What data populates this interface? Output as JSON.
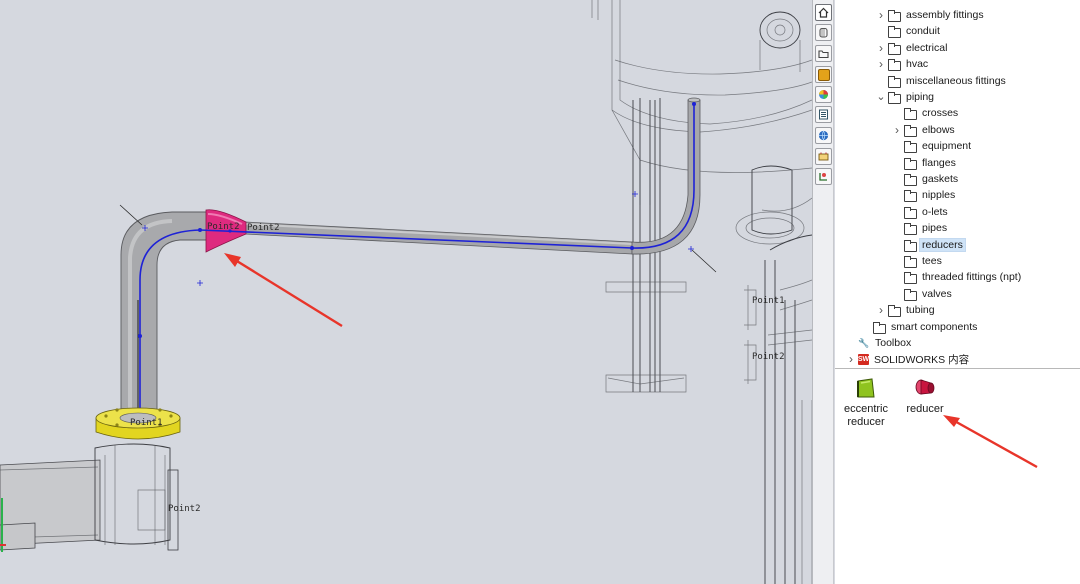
{
  "viewport": {
    "point_labels": [
      "Point2",
      "Point2",
      "Point2",
      "Point1",
      "Point2",
      "Point1"
    ],
    "colors": {
      "pipe": "#a9a9ab",
      "route_line": "#1e22d6",
      "reducer": "#de2a7f",
      "flange": "#e2d520",
      "annotation_arrow": "#e8352a"
    }
  },
  "taskpane_tabs": [
    {
      "name": "home-icon",
      "active": true
    },
    {
      "name": "design-library-icon",
      "active": false
    },
    {
      "name": "file-explorer-icon",
      "active": false
    },
    {
      "name": "view-palette-icon",
      "active": false
    },
    {
      "name": "appearances-icon",
      "active": false
    },
    {
      "name": "custom-properties-icon",
      "active": false
    },
    {
      "name": "solidworks-forum-icon",
      "active": false
    },
    {
      "name": "plugins-icon",
      "active": false
    },
    {
      "name": "routing-library-icon",
      "active": false
    }
  ],
  "tree": {
    "items": [
      {
        "label": "assembly fittings",
        "level": 1,
        "expand": "collapsed",
        "icon": "folder-icon"
      },
      {
        "label": "conduit",
        "level": 1,
        "expand": "none",
        "icon": "folder-icon"
      },
      {
        "label": "electrical",
        "level": 1,
        "expand": "collapsed",
        "icon": "folder-icon"
      },
      {
        "label": "hvac",
        "level": 1,
        "expand": "collapsed",
        "icon": "folder-icon"
      },
      {
        "label": "miscellaneous fittings",
        "level": 1,
        "expand": "none",
        "icon": "folder-icon"
      },
      {
        "label": "piping",
        "level": 1,
        "expand": "expanded",
        "icon": "folder-icon"
      },
      {
        "label": "crosses",
        "level": 2,
        "expand": "none",
        "icon": "folder-icon"
      },
      {
        "label": "elbows",
        "level": 2,
        "expand": "collapsed",
        "icon": "folder-icon"
      },
      {
        "label": "equipment",
        "level": 2,
        "expand": "none",
        "icon": "folder-icon"
      },
      {
        "label": "flanges",
        "level": 2,
        "expand": "none",
        "icon": "folder-icon"
      },
      {
        "label": "gaskets",
        "level": 2,
        "expand": "none",
        "icon": "folder-icon"
      },
      {
        "label": "nipples",
        "level": 2,
        "expand": "none",
        "icon": "folder-icon"
      },
      {
        "label": "o-lets",
        "level": 2,
        "expand": "none",
        "icon": "folder-icon"
      },
      {
        "label": "pipes",
        "level": 2,
        "expand": "none",
        "icon": "folder-icon"
      },
      {
        "label": "reducers",
        "level": 2,
        "expand": "none",
        "icon": "folder-icon",
        "selected": true
      },
      {
        "label": "tees",
        "level": 2,
        "expand": "none",
        "icon": "folder-icon"
      },
      {
        "label": "threaded fittings (npt)",
        "level": 2,
        "expand": "none",
        "icon": "folder-icon"
      },
      {
        "label": "valves",
        "level": 2,
        "expand": "none",
        "icon": "folder-icon"
      },
      {
        "label": "tubing",
        "level": 1,
        "expand": "collapsed",
        "icon": "folder-icon"
      },
      {
        "label": "smart components",
        "level": 0,
        "expand": "none",
        "icon": "folder-icon"
      },
      {
        "label": "Toolbox",
        "level": -1,
        "expand": "none",
        "icon": "toolbox-icon"
      },
      {
        "label": "SOLIDWORKS 内容",
        "level": -1,
        "expand": "collapsed",
        "icon": "solidworks-content-icon"
      }
    ]
  },
  "library": {
    "items": [
      {
        "label_line1": "eccentric",
        "label_line2": "reducer",
        "icon": "eccentric-reducer-icon",
        "color": "#8fc31f"
      },
      {
        "label_line1": "reducer",
        "label_line2": "",
        "icon": "reducer-icon",
        "color": "#c8153f"
      }
    ]
  }
}
